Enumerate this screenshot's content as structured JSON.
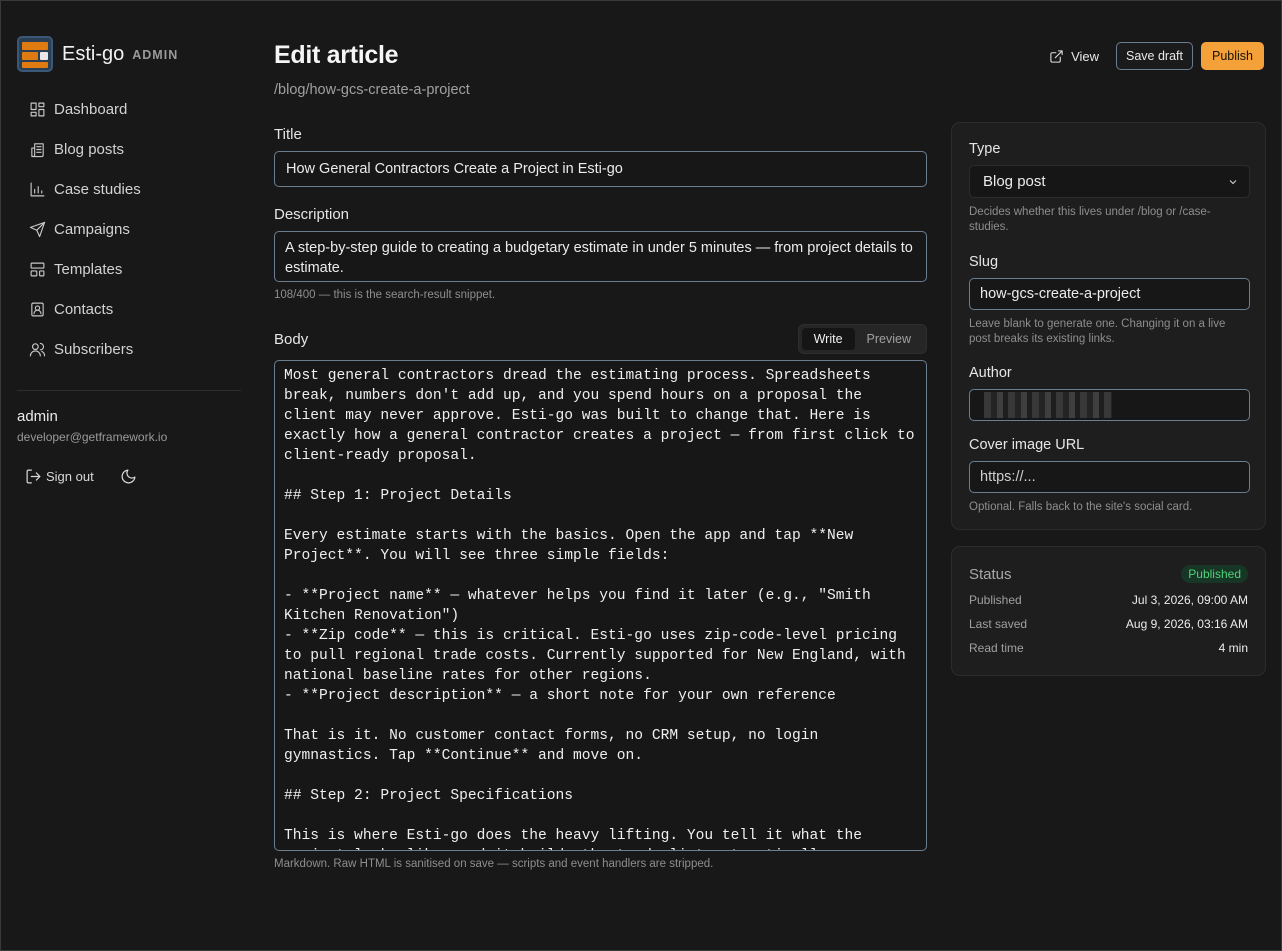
{
  "brand": {
    "name": "Esti-go",
    "tag": "ADMIN"
  },
  "nav": [
    {
      "label": "Dashboard",
      "icon": "dashboard-icon"
    },
    {
      "label": "Blog posts",
      "icon": "newspaper-icon"
    },
    {
      "label": "Case studies",
      "icon": "bar-chart-icon"
    },
    {
      "label": "Campaigns",
      "icon": "send-icon"
    },
    {
      "label": "Templates",
      "icon": "layout-icon"
    },
    {
      "label": "Contacts",
      "icon": "contact-icon"
    },
    {
      "label": "Subscribers",
      "icon": "users-icon"
    }
  ],
  "user": {
    "name": "admin",
    "email": "developer@getframework.io",
    "sign_out": "Sign out"
  },
  "header": {
    "title": "Edit article",
    "path": "/blog/how-gcs-create-a-project"
  },
  "actions": {
    "view": "View",
    "save_draft": "Save draft",
    "publish": "Publish"
  },
  "form": {
    "title_label": "Title",
    "title_value": "How General Contractors Create a Project in Esti-go",
    "description_label": "Description",
    "description_value": "A step-by-step guide to creating a budgetary estimate in under 5 minutes — from project details to estimate.",
    "description_hint": "108/400 — this is the search-result snippet.",
    "body_label": "Body",
    "tab_write": "Write",
    "tab_preview": "Preview",
    "body_value": "Most general contractors dread the estimating process. Spreadsheets break, numbers don't add up, and you spend hours on a proposal the client may never approve. Esti-go was built to change that. Here is exactly how a general contractor creates a project — from first click to client-ready proposal.\n\n## Step 1: Project Details\n\nEvery estimate starts with the basics. Open the app and tap **New Project**. You will see three simple fields:\n\n- **Project name** — whatever helps you find it later (e.g., \"Smith Kitchen Renovation\")\n- **Zip code** — this is critical. Esti-go uses zip-code-level pricing to pull regional trade costs. Currently supported for New England, with national baseline rates for other regions.\n- **Project description** — a short note for your own reference\n\nThat is it. No customer contact forms, no CRM setup, no login gymnastics. Tap **Continue** and move on.\n\n## Step 2: Project Specifications\n\nThis is where Esti-go does the heavy lifting. You tell it what the project looks like, and it builds the trade list automatically.",
    "body_hint": "Markdown. Raw HTML is sanitised on save — scripts and event handlers are stripped."
  },
  "settings": {
    "type_label": "Type",
    "type_value": "Blog post",
    "type_hint": "Decides whether this lives under /blog or /case-studies.",
    "slug_label": "Slug",
    "slug_value": "how-gcs-create-a-project",
    "slug_hint": "Leave blank to generate one. Changing it on a live post breaks its existing links.",
    "author_label": "Author",
    "cover_label": "Cover image URL",
    "cover_placeholder": "https://...",
    "cover_hint": "Optional. Falls back to the site's social card."
  },
  "status": {
    "title": "Status",
    "badge": "Published",
    "rows": [
      {
        "k": "Published",
        "v": "Jul 3, 2026, 09:00 AM"
      },
      {
        "k": "Last saved",
        "v": "Aug 9, 2026, 03:16 AM"
      },
      {
        "k": "Read time",
        "v": "4 min"
      }
    ]
  }
}
